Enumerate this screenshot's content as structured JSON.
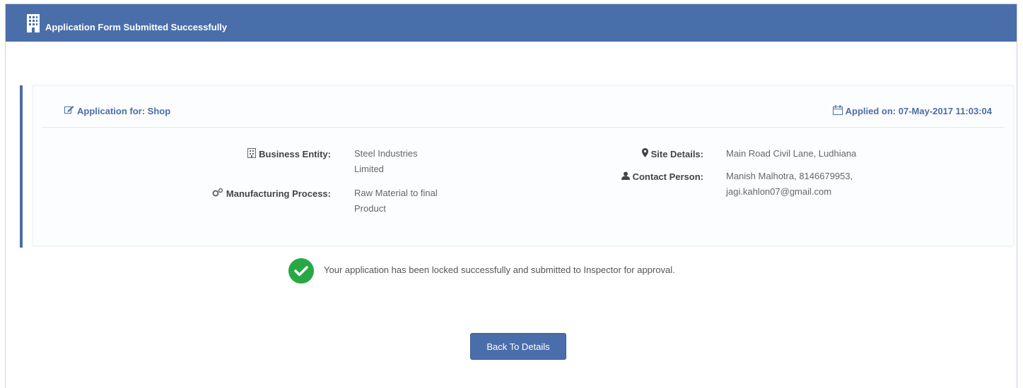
{
  "header": {
    "icon": "building-icon",
    "title": "Application Form Submitted Successfully"
  },
  "summary": {
    "application_for": "Application for: Shop",
    "applied_on": "Applied on: 07-May-2017 11:03:04",
    "fields": {
      "business_entity": {
        "label": "Business Entity:",
        "value_line1": "Steel Industries",
        "value_line2": "Limited"
      },
      "manufacturing_process": {
        "label": "Manufacturing Process:",
        "value_line1": "Raw Material to final",
        "value_line2": "Product"
      },
      "site_details": {
        "label": "Site Details:",
        "value_line1": "Main Road Civil Lane, Ludhiana"
      },
      "contact_person": {
        "label": "Contact Person:",
        "value_line1": "Manish Malhotra, 8146679953,",
        "value_line2": "jagi.kahlon07@gmail.com"
      }
    }
  },
  "status": {
    "message": "Your application has been locked successfully and submitted to Inspector for approval."
  },
  "actions": {
    "back_label": "Back To Details"
  },
  "colors": {
    "primary": "#4a6ea9",
    "success": "#27a844"
  }
}
